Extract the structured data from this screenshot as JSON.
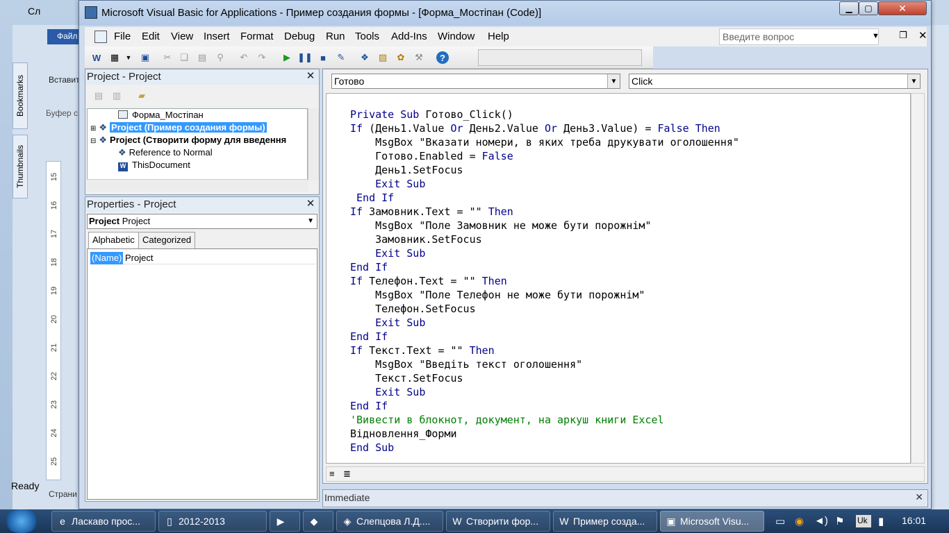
{
  "background": {
    "left_title": "Сл",
    "file_tab": "Файл",
    "paste_label": "Вставит",
    "clipboard_label": "Буфер с",
    "vtabs": [
      "Bookmarks",
      "Thumbnails"
    ],
    "ruler": [
      "15",
      "16",
      "17",
      "18",
      "19",
      "20",
      "21",
      "22",
      "23",
      "24",
      "25"
    ],
    "status_ready": "Ready",
    "pages_label": "Страни"
  },
  "window": {
    "title": "Microsoft Visual Basic for Applications - Пример создания формы - [Форма_Мостіпан (Code)]"
  },
  "menu": {
    "items": [
      "File",
      "Edit",
      "View",
      "Insert",
      "Format",
      "Debug",
      "Run",
      "Tools",
      "Add-Ins",
      "Window",
      "Help"
    ],
    "ask_placeholder": "Введите вопрос"
  },
  "project": {
    "title": "Project - Project",
    "tree": [
      {
        "label": "Форма_Мостіпан",
        "indent": 3
      },
      {
        "label": "Project (Пример создания формы)",
        "indent": 0,
        "selected": true
      },
      {
        "label": "Project (Створити форму для введення",
        "indent": 0
      },
      {
        "label": "Reference to Normal",
        "indent": 2
      },
      {
        "label": "ThisDocument",
        "indent": 2
      }
    ]
  },
  "properties": {
    "title": "Properties - Project",
    "object_bold": "Project",
    "object_type": "Project",
    "tabs": [
      "Alphabetic",
      "Categorized"
    ],
    "row_name": "(Name)",
    "row_value": "Project"
  },
  "code": {
    "object_combo": "Готово",
    "proc_combo": "Click",
    "lines": [
      "Private Sub Готово_Click()",
      "If (День1.Value Or День2.Value Or День3.Value) = False Then",
      "    MsgBox \"Вказати номери, в яких треба друкувати оголошення\"",
      "    Готово.Enabled = False",
      "    День1.SetFocus",
      "    Exit Sub",
      " End If",
      "If Замовник.Text = \"\" Then",
      "    MsgBox \"Поле Замовник не може бути порожнім\"",
      "    Замовник.SetFocus",
      "    Exit Sub",
      "End If",
      "If Телефон.Text = \"\" Then",
      "    MsgBox \"Поле Телефон не може бути порожнім\"",
      "    Телефон.SetFocus",
      "    Exit Sub",
      "End If",
      "If Текст.Text = \"\" Then",
      "    MsgBox \"Введіть текст оголошення\"",
      "    Текст.SetFocus",
      "    Exit Sub",
      "End If",
      "'Вивести в блокнот, документ, на аркуш книги Excel",
      "Відновлення_Форми",
      "End Sub"
    ]
  },
  "immediate": {
    "title": "Immediate"
  },
  "taskbar": {
    "tasks": [
      {
        "label": "Ласкаво прос...",
        "icon": "e"
      },
      {
        "label": "2012-2013",
        "icon": "▯"
      },
      {
        "label": "",
        "icon": "▶"
      },
      {
        "label": "",
        "icon": "◆"
      },
      {
        "label": "Слепцова Л.Д....",
        "icon": "◈"
      },
      {
        "label": "Створити фор...",
        "icon": "W"
      },
      {
        "label": "Пример созда...",
        "icon": "W"
      },
      {
        "label": "Microsoft Visu...",
        "icon": "▣",
        "active": true
      }
    ],
    "lang": "Uk",
    "time": "16:01"
  }
}
